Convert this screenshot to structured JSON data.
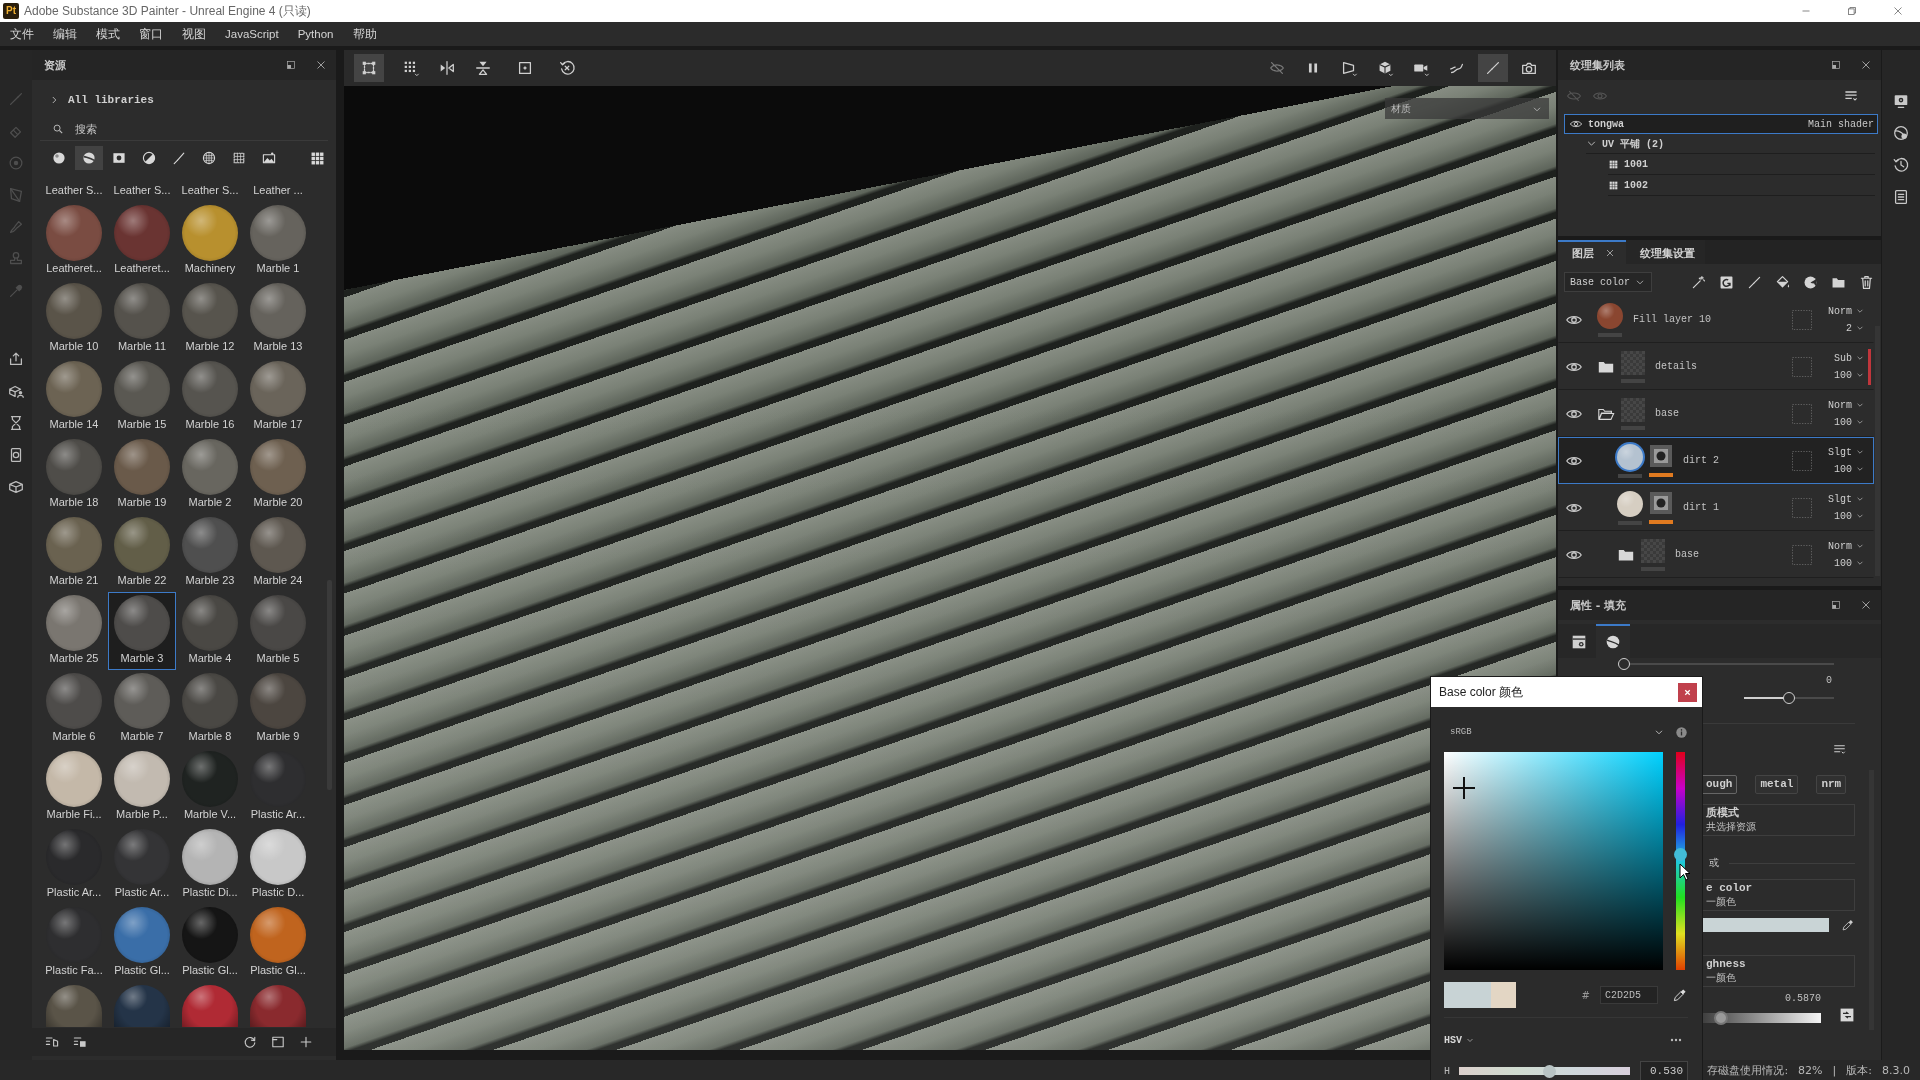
{
  "window": {
    "logo": "Pt",
    "title": "Adobe Substance 3D Painter - Unreal Engine 4 (只读)"
  },
  "menu": [
    "文件",
    "编辑",
    "模式",
    "窗口",
    "视图",
    "JavaScript",
    "Python",
    "帮助"
  ],
  "assets": {
    "title": "资源",
    "library": "All libraries",
    "search": {
      "placeholder": "搜索"
    },
    "filters": [
      {
        "selected": false
      },
      {
        "selected": true
      },
      {
        "selected": false
      },
      {
        "selected": false
      },
      {
        "selected": false
      },
      {
        "selected": false
      },
      {
        "selected": false
      },
      {
        "selected": false
      }
    ],
    "items": [
      {
        "label": "Leather S...",
        "selected": false
      },
      {
        "label": "Leather S...",
        "selected": false
      },
      {
        "label": "Leather S...",
        "selected": false
      },
      {
        "label": "Leather ...",
        "selected": false
      },
      {
        "label": "Leatheret...",
        "color": "#7a4c42",
        "selected": false
      },
      {
        "label": "Leatheret...",
        "color": "#6a3432",
        "selected": false
      },
      {
        "label": "Machinery",
        "color": "#b8902e",
        "selected": false
      },
      {
        "label": "Marble 1",
        "color": "#66635d",
        "selected": false
      },
      {
        "label": "Marble 10",
        "color": "#5a5449",
        "selected": false
      },
      {
        "label": "Marble 11",
        "color": "#55524c",
        "selected": false
      },
      {
        "label": "Marble 12",
        "color": "#57544d",
        "selected": false
      },
      {
        "label": "Marble 13",
        "color": "#65625c",
        "selected": false
      },
      {
        "label": "Marble 14",
        "color": "#6c6353",
        "selected": false
      },
      {
        "label": "Marble 15",
        "color": "#5a5852",
        "selected": false
      },
      {
        "label": "Marble 16",
        "color": "#56544f",
        "selected": false
      },
      {
        "label": "Marble 17",
        "color": "#6a645a",
        "selected": false
      },
      {
        "label": "Marble 18",
        "color": "#4f4d49",
        "selected": false
      },
      {
        "label": "Marble 19",
        "color": "#6a5a4a",
        "selected": false
      },
      {
        "label": "Marble 2",
        "color": "#68665f",
        "selected": false
      },
      {
        "label": "Marble 20",
        "color": "#6e6050",
        "selected": false
      },
      {
        "label": "Marble 21",
        "color": "#6a6250",
        "selected": false
      },
      {
        "label": "Marble 22",
        "color": "#625e48",
        "selected": false
      },
      {
        "label": "Marble 23",
        "color": "#4f4f4f",
        "selected": false
      },
      {
        "label": "Marble 24",
        "color": "#5e5850",
        "selected": false
      },
      {
        "label": "Marble 25",
        "color": "#7a7670",
        "selected": false
      },
      {
        "label": "Marble 3",
        "color": "#4e4c4a",
        "selected": true
      },
      {
        "label": "Marble 4",
        "color": "#4a4844",
        "selected": false
      },
      {
        "label": "Marble 5",
        "color": "#4a4846",
        "selected": false
      },
      {
        "label": "Marble 6",
        "color": "#4e4c4a",
        "selected": false
      },
      {
        "label": "Marble 7",
        "color": "#5e5c58",
        "selected": false
      },
      {
        "label": "Marble 8",
        "color": "#4a4844",
        "selected": false
      },
      {
        "label": "Marble 9",
        "color": "#4c4640",
        "selected": false
      },
      {
        "label": "Marble Fi...",
        "color": "#c4b8a8",
        "selected": false
      },
      {
        "label": "Marble P...",
        "color": "#c2bab0",
        "selected": false
      },
      {
        "label": "Marble V...",
        "color": "#1f2321",
        "selected": false
      },
      {
        "label": "Plastic Ar...",
        "color": "#2e2e30",
        "selected": false
      },
      {
        "label": "Plastic Ar...",
        "color": "#2a2a2c",
        "selected": false
      },
      {
        "label": "Plastic Ar...",
        "color": "#343436",
        "selected": false
      },
      {
        "label": "Plastic Di...",
        "color": "#b4b4b4",
        "selected": false
      },
      {
        "label": "Plastic D...",
        "color": "#c8c8c8",
        "selected": false
      },
      {
        "label": "Plastic Fa...",
        "color": "#2e2e30",
        "selected": false
      },
      {
        "label": "Plastic Gl...",
        "color": "#3a6ea8",
        "selected": false
      },
      {
        "label": "Plastic Gl...",
        "color": "#151515",
        "selected": false
      },
      {
        "label": "Plastic Gl...",
        "color": "#c0641e",
        "selected": false
      },
      {
        "color": "#5a5448",
        "selected": false
      },
      {
        "color": "#243448",
        "selected": false
      },
      {
        "color": "#b02a34",
        "selected": false
      },
      {
        "color": "#8a2a2e",
        "selected": false
      }
    ]
  },
  "viewport": {
    "toolbar_left": [
      {
        "selected": true
      },
      {
        "selected": false
      },
      {
        "selected": false
      },
      {
        "selected": false
      },
      {
        "selected": false
      },
      {
        "selected": false
      }
    ],
    "toolbar_right": [
      {
        "selected": false
      },
      {
        "selected": false
      },
      {
        "selected": false
      },
      {
        "selected": false
      },
      {
        "selected": false
      },
      {
        "selected": false
      },
      {
        "selected": true
      },
      {
        "selected": false
      }
    ],
    "view_dropdown": "材质"
  },
  "texture_set_list": {
    "title": "纹理集列表",
    "sets": [
      {
        "name": "tongwa",
        "shader": "Main shader",
        "visible": true,
        "selected": true,
        "children": [
          {
            "name": "UV 平铺 (2)",
            "expanded": true,
            "children": [
              {
                "name": "1001"
              },
              {
                "name": "1002"
              }
            ]
          }
        ]
      }
    ]
  },
  "layers": {
    "tabs": [
      {
        "label": "图层",
        "selected": true,
        "closable": true
      },
      {
        "label": "纹理集设置",
        "selected": false,
        "closable": false
      }
    ],
    "channel": "Base color",
    "items": [
      {
        "name": "Fill layer 10",
        "kind": "fill",
        "color": "#8a4630",
        "mask": false,
        "visible": true,
        "blend": "Norm",
        "opacity": "2",
        "selected": false
      },
      {
        "name": "details",
        "kind": "folder",
        "expanded": false,
        "tag": {
          "color": "#c0363c"
        },
        "visible": true,
        "blend": "Sub",
        "opacity": "100",
        "selected": false
      },
      {
        "name": "base",
        "kind": "folder",
        "expanded": true,
        "visible": true,
        "blend": "Norm",
        "opacity": "100",
        "selected": false,
        "children": [
          {
            "name": "dirt 2",
            "kind": "fill",
            "color": "#b4c2d0",
            "mask": true,
            "visible": true,
            "blend": "Slgt",
            "opacity": "100",
            "selected": true
          },
          {
            "name": "dirt 1",
            "kind": "fill",
            "color": "#d6cec2",
            "mask": true,
            "visible": true,
            "blend": "Slgt",
            "opacity": "100",
            "selected": false
          },
          {
            "name": "base",
            "kind": "folder",
            "expanded": false,
            "visible": true,
            "blend": "Norm",
            "opacity": "100",
            "selected": false
          }
        ]
      }
    ]
  },
  "properties": {
    "title": "属性 - 填充",
    "tabs": [
      {
        "selected": false
      },
      {
        "selected": true
      }
    ],
    "sliders": [
      {
        "level": 0
      },
      {
        "level": 0.5,
        "reading": "0"
      }
    ],
    "channel_buttons": [
      "ough",
      "metal",
      "nrm"
    ],
    "material_mode": {
      "label": "质模式",
      "value": "共选择资源"
    },
    "separator_label": "或",
    "base_color": {
      "label": "e color",
      "value": "一颜色",
      "color": "#c9d4d6"
    },
    "roughness": {
      "label": "ghness",
      "value": "一颜色",
      "reading": "0.5870",
      "level": 0.17
    }
  },
  "color_dialog": {
    "title": "Base color 颜色",
    "color_space": "sRGB",
    "hue": {
      "level": 0.53
    },
    "swatches": [
      {
        "color": "#c8d3d5"
      },
      {
        "color": "#e3d6c4"
      }
    ],
    "hex_prefix": "#",
    "hex": "C2D2D5",
    "mode": "HSV",
    "channels": [
      {
        "label": "H",
        "level": 0.53,
        "value": "0.530"
      }
    ]
  },
  "status_bar": [
    "存磁盘使用情况:",
    "82%",
    "|",
    "版本:",
    "8.3.0"
  ]
}
